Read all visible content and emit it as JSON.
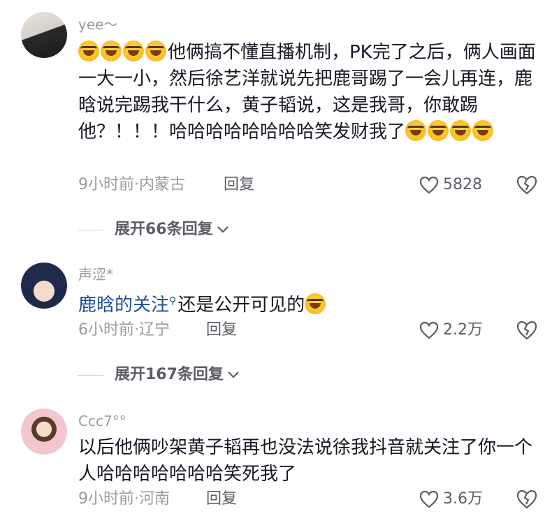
{
  "comments": [
    {
      "username": "yee～",
      "text_before": "他俩搞不懂直播机制，PK完了之后，俩人画面一大一小，然后徐艺洋就说先把鹿哥踢了一会儿再连，鹿晗说完踢我干什么，黄子韬说，这是我哥，你敢踢他？！！！哈哈哈哈哈哈哈哈笑发财我了",
      "time_location": "9小时前·内蒙古",
      "reply_label": "回复",
      "likes": "5828",
      "expand_label": "展开66条回复"
    },
    {
      "username": "声涩*",
      "mention": "鹿晗的关注",
      "text_after": "还是公开可见的",
      "time_location": "6小时前·辽宁",
      "reply_label": "回复",
      "likes": "2.2万",
      "expand_label": "展开167条回复"
    },
    {
      "username": "Ccc7°°",
      "text": "以后他俩吵架黄子韬再也没法说徐我抖音就关注了你一个人哈哈哈哈哈哈哈笑死我了",
      "time_location": "9小时前·河南",
      "reply_label": "回复",
      "likes": "3.6万"
    }
  ],
  "icons": {
    "emoji": "laughing-crying-emoji-icon",
    "like": "heart-outline-icon",
    "dislike": "broken-heart-icon",
    "expand": "chevron-down-icon",
    "mention": "search-icon"
  }
}
